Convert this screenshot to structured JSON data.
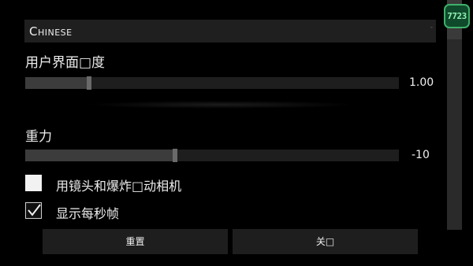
{
  "language": {
    "selected": "Chinese"
  },
  "ui_scale": {
    "label": "用户界面□度",
    "value_text": "1.00",
    "level": 0.17
  },
  "gravity": {
    "label": "重力",
    "value_text": "-10",
    "level": 0.4
  },
  "options": [
    {
      "label": "用镜头和爆炸□动相机",
      "checked": false
    },
    {
      "label": "显示每秒帧",
      "checked": true
    }
  ],
  "buttons": {
    "reset": "重置",
    "close": "关□"
  },
  "fps_badge": "7723",
  "colors": {
    "background": "#000000",
    "badge_green": "#3fb06a"
  }
}
